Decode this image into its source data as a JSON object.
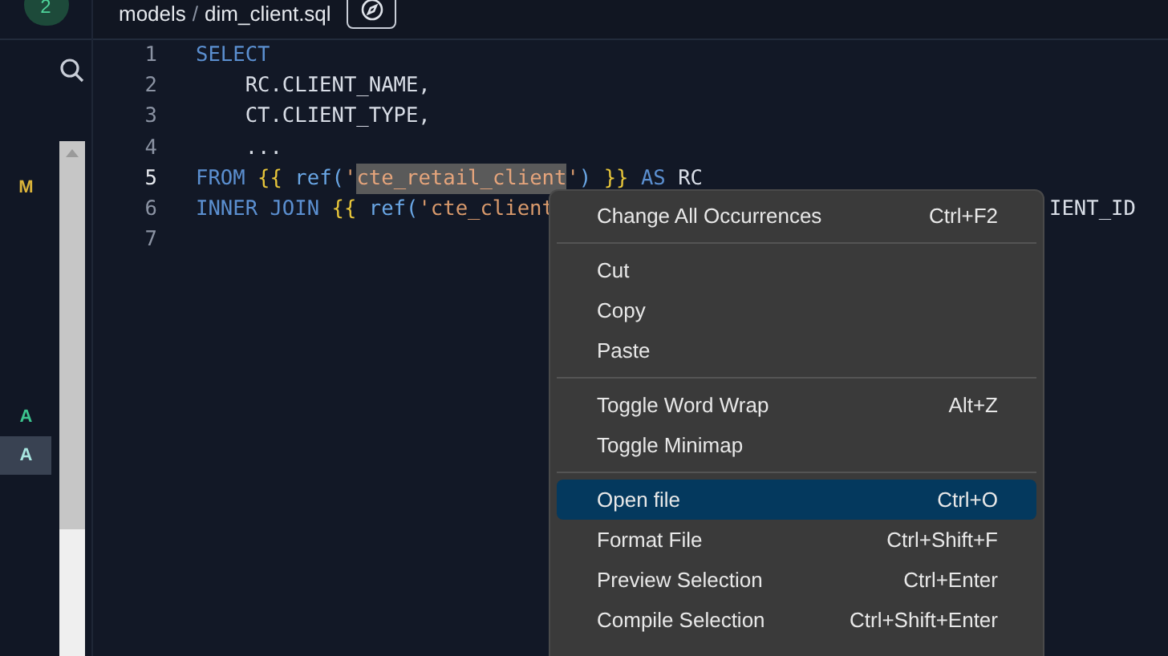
{
  "sidebar": {
    "badge": "2",
    "rows": [
      {
        "status": "M",
        "color": "#dcb43a",
        "selected": false
      },
      {
        "status": "A",
        "color": "#3cc48e",
        "selected": false
      },
      {
        "status": "A",
        "color": "#a8e6e0",
        "selected": true
      }
    ]
  },
  "breadcrumb": {
    "folder": "models",
    "separator": "/",
    "file": "dim_client.sql"
  },
  "editor": {
    "lines": [
      {
        "number": "1",
        "current": false,
        "tokens": [
          {
            "kind": "keyword",
            "text": "SELECT"
          }
        ]
      },
      {
        "number": "2",
        "current": false,
        "tokens": [
          {
            "kind": "plain",
            "text": "    RC.CLIENT_NAME,"
          }
        ]
      },
      {
        "number": "3",
        "current": false,
        "tokens": [
          {
            "kind": "plain",
            "text": "    CT.CLIENT_TYPE,"
          }
        ]
      },
      {
        "number": "4",
        "current": false,
        "tokens": [
          {
            "kind": "plain",
            "text": "    ..."
          }
        ]
      },
      {
        "number": "5",
        "current": true,
        "tokens": [
          {
            "kind": "keyword",
            "text": "FROM "
          },
          {
            "kind": "brace",
            "text": "{{ "
          },
          {
            "kind": "function",
            "text": "ref("
          },
          {
            "kind": "string",
            "text": "'"
          },
          {
            "kind": "highlight",
            "text": "cte_retail_client"
          },
          {
            "kind": "string",
            "text": "'"
          },
          {
            "kind": "function",
            "text": ") "
          },
          {
            "kind": "brace",
            "text": "}}"
          },
          {
            "kind": "keyword",
            "text": " AS "
          },
          {
            "kind": "plain",
            "text": "RC"
          }
        ]
      },
      {
        "number": "6",
        "current": false,
        "tokens": [
          {
            "kind": "keyword",
            "text": "INNER JOIN "
          },
          {
            "kind": "brace",
            "text": "{{ "
          },
          {
            "kind": "function",
            "text": "ref("
          },
          {
            "kind": "string",
            "text": "'cte_client"
          }
        ],
        "right_text": "IENT_ID"
      },
      {
        "number": "7",
        "current": false
      }
    ]
  },
  "context_menu": {
    "groups": [
      [
        {
          "label": "Change All Occurrences",
          "shortcut": "Ctrl+F2",
          "selected": false
        }
      ],
      [
        {
          "label": "Cut",
          "selected": false
        },
        {
          "label": "Copy",
          "selected": false
        },
        {
          "label": "Paste",
          "selected": false
        }
      ],
      [
        {
          "label": "Toggle Word Wrap",
          "shortcut": "Alt+Z",
          "selected": false
        },
        {
          "label": "Toggle Minimap",
          "selected": false
        }
      ],
      [
        {
          "label": "Open file",
          "shortcut": "Ctrl+O",
          "selected": true
        },
        {
          "label": "Format File",
          "shortcut": "Ctrl+Shift+F",
          "selected": false
        },
        {
          "label": "Preview Selection",
          "shortcut": "Ctrl+Enter",
          "selected": false
        },
        {
          "label": "Compile Selection",
          "shortcut": "Ctrl+Shift+Enter",
          "selected": false
        }
      ]
    ]
  }
}
